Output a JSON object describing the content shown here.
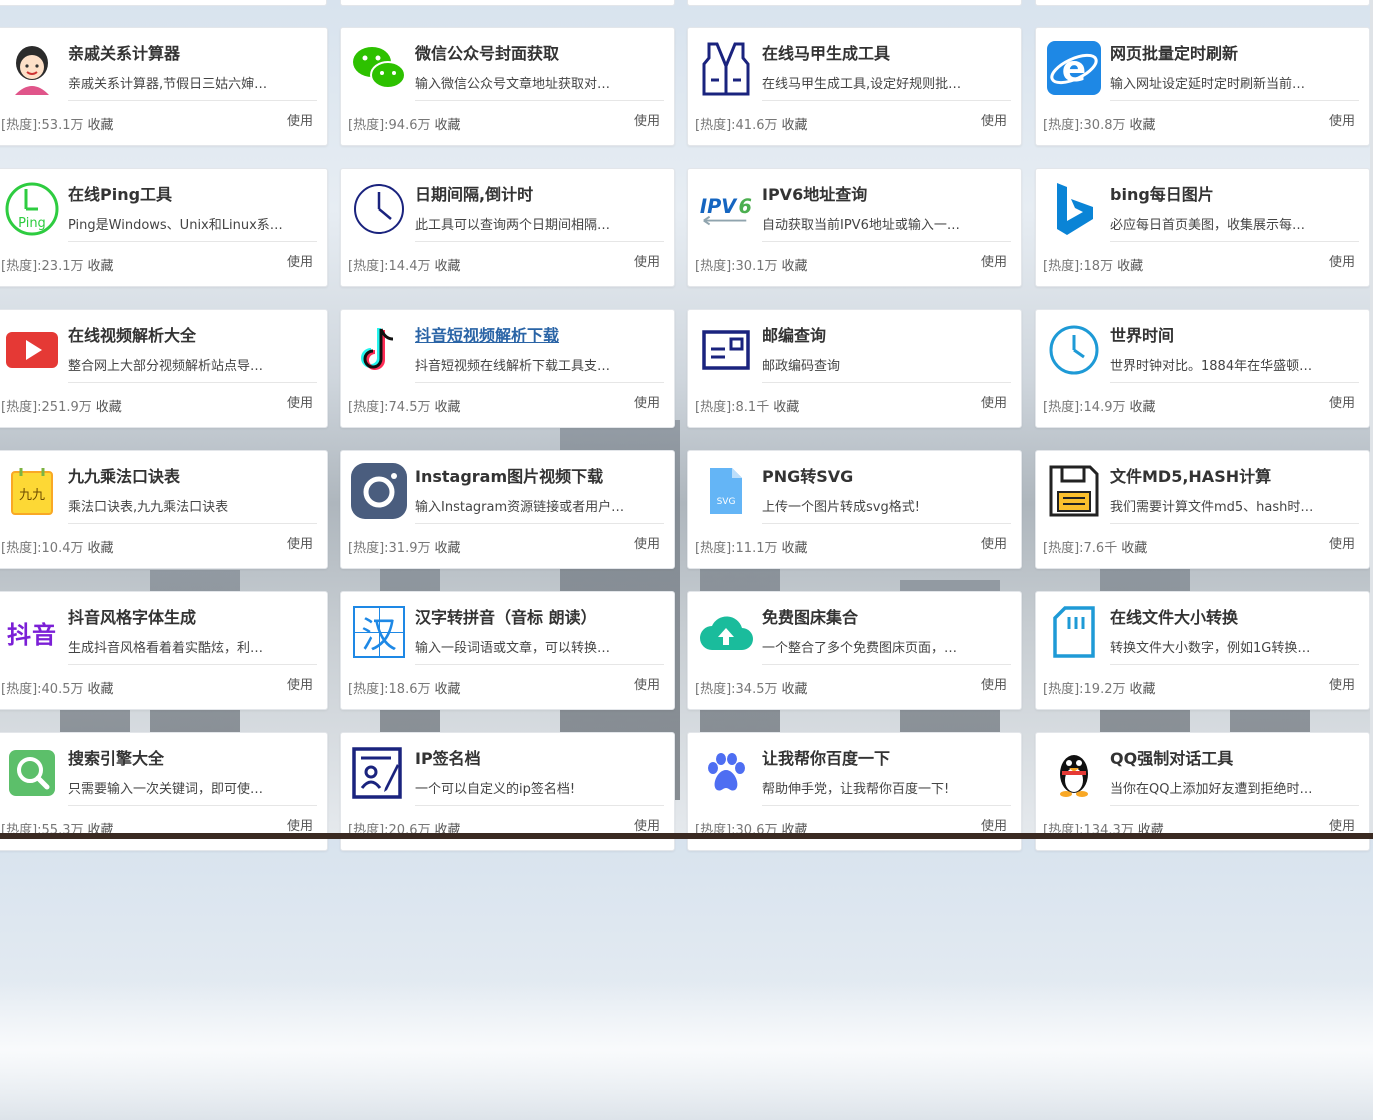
{
  "rows": [
    [
      {
        "title": "亲戚关系计算器",
        "desc": "亲戚关系计算器,节假日三姑六婶…",
        "hot": "[热度]:53.1万",
        "fav": "收藏",
        "use": "使用",
        "icon": "person-avatar-icon"
      },
      {
        "title": "微信公众号封面获取",
        "desc": "输入微信公众号文章地址获取对…",
        "hot": "[热度]:94.6万",
        "fav": "收藏",
        "use": "使用",
        "icon": "wechat-icon"
      },
      {
        "title": "在线马甲生成工具",
        "desc": "在线马甲生成工具,设定好规则批…",
        "hot": "[热度]:41.6万",
        "fav": "收藏",
        "use": "使用",
        "icon": "vest-icon"
      },
      {
        "title": "网页批量定时刷新",
        "desc": "输入网址设定延时定时刷新当前…",
        "hot": "[热度]:30.8万",
        "fav": "收藏",
        "use": "使用",
        "icon": "ie-browser-icon"
      }
    ],
    [
      {
        "title": "在线Ping工具",
        "desc": "Ping是Windows、Unix和Linux系…",
        "hot": "[热度]:23.1万",
        "fav": "收藏",
        "use": "使用",
        "icon": "ping-clock-icon"
      },
      {
        "title": "日期间隔,倒计时",
        "desc": "此工具可以查询两个日期间相隔…",
        "hot": "[热度]:14.4万",
        "fav": "收藏",
        "use": "使用",
        "icon": "clock-icon"
      },
      {
        "title": "IPV6地址查询",
        "desc": "自动获取当前IPV6地址或输入一…",
        "hot": "[热度]:30.1万",
        "fav": "收藏",
        "use": "使用",
        "icon": "ipv6-icon"
      },
      {
        "title": "bing每日图片",
        "desc": "必应每日首页美图，收集展示每…",
        "hot": "[热度]:18万",
        "fav": "收藏",
        "use": "使用",
        "icon": "bing-icon"
      }
    ],
    [
      {
        "title": "在线视频解析大全",
        "desc": "整合网上大部分视频解析站点导…",
        "hot": "[热度]:251.9万",
        "fav": "收藏",
        "use": "使用",
        "icon": "video-play-icon"
      },
      {
        "title": "抖音短视频解析下载",
        "desc": "抖音短视频在线解析下载工具支…",
        "hot": "[热度]:74.5万",
        "fav": "收藏",
        "use": "使用",
        "icon": "tiktok-icon",
        "link": true
      },
      {
        "title": "邮编查询",
        "desc": "邮政编码查询",
        "hot": "[热度]:8.1千",
        "fav": "收藏",
        "use": "使用",
        "icon": "postcard-icon"
      },
      {
        "title": "世界时间",
        "desc": "世界时钟对比。1884年在华盛顿…",
        "hot": "[热度]:14.9万",
        "fav": "收藏",
        "use": "使用",
        "icon": "world-clock-icon"
      }
    ],
    [
      {
        "title": "九九乘法口诀表",
        "desc": "乘法口诀表,九九乘法口诀表",
        "hot": "[热度]:10.4万",
        "fav": "收藏",
        "use": "使用",
        "icon": "multiplication-notepad-icon",
        "icontext": "九九"
      },
      {
        "title": "Instagram图片视频下载",
        "desc": "输入Instagram资源链接或者用户…",
        "hot": "[热度]:31.9万",
        "fav": "收藏",
        "use": "使用",
        "icon": "instagram-icon"
      },
      {
        "title": "PNG转SVG",
        "desc": "上传一个图片转成svg格式!",
        "hot": "[热度]:11.1万",
        "fav": "收藏",
        "use": "使用",
        "icon": "svg-file-icon",
        "icontext": "SVG"
      },
      {
        "title": "文件MD5,HASH计算",
        "desc": "我们需要计算文件md5、hash时…",
        "hot": "[热度]:7.6千",
        "fav": "收藏",
        "use": "使用",
        "icon": "floppy-disk-icon"
      }
    ],
    [
      {
        "title": "抖音风格字体生成",
        "desc": "生成抖音风格看着着实酷炫，利…",
        "hot": "[热度]:40.5万",
        "fav": "收藏",
        "use": "使用",
        "icon": "douyin-text-icon",
        "icontext": "抖音"
      },
      {
        "title": "汉字转拼音（音标 朗读）",
        "desc": "输入一段词语或文章，可以转换…",
        "hot": "[热度]:18.6万",
        "fav": "收藏",
        "use": "使用",
        "icon": "hanzi-icon",
        "icontext": "汉"
      },
      {
        "title": "免费图床集合",
        "desc": "一个整合了多个免费图床页面，…",
        "hot": "[热度]:34.5万",
        "fav": "收藏",
        "use": "使用",
        "icon": "cloud-upload-icon"
      },
      {
        "title": "在线文件大小转换",
        "desc": "转换文件大小数字，例如1G转换…",
        "hot": "[热度]:19.2万",
        "fav": "收藏",
        "use": "使用",
        "icon": "sd-card-icon"
      }
    ],
    [
      {
        "title": "搜索引擎大全",
        "desc": "只需要输入一次关键词，即可使…",
        "hot": "[热度]:55.3万",
        "fav": "收藏",
        "use": "使用",
        "icon": "search-icon"
      },
      {
        "title": "IP签名档",
        "desc": "一个可以自定义的ip签名档!",
        "hot": "[热度]:20.6万",
        "fav": "收藏",
        "use": "使用",
        "icon": "id-card-signature-icon"
      },
      {
        "title": "让我帮你百度一下",
        "desc": "帮助伸手党，让我帮你百度一下!",
        "hot": "[热度]:30.6万",
        "fav": "收藏",
        "use": "使用",
        "icon": "paw-icon"
      },
      {
        "title": "QQ强制对话工具",
        "desc": "当你在QQ上添加好友遭到拒绝时…",
        "hot": "[热度]:134.3万",
        "fav": "收藏",
        "use": "使用",
        "icon": "qq-penguin-icon"
      }
    ]
  ]
}
